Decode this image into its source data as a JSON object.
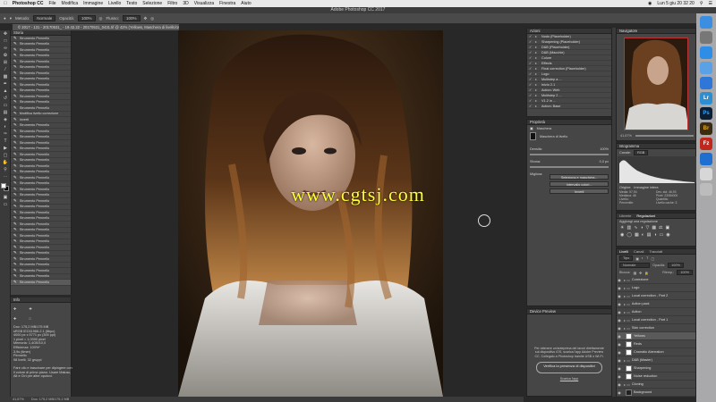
{
  "menubar": {
    "app_name": "Photoshop CC",
    "menus": [
      "File",
      "Modifica",
      "Immagine",
      "Livello",
      "Testo",
      "Selezione",
      "Filtro",
      "3D",
      "Visualizza",
      "Finestra",
      "Aiuto"
    ],
    "datetime": "Lun 5 giu  20 32 20"
  },
  "window_title": "Adobe Photoshop CC 2017",
  "options": {
    "metodo_label": "Metodo:",
    "metodo_value": "Normale",
    "opacita_label": "Opacità:",
    "opacita_value": "100%",
    "flusso_label": "Flusso:",
    "flusso_value": "100%"
  },
  "document_tab": "© 2017 - 131 - 20170531_ - 19.42.22 - 20170531_0431.tif @ 42% (Yellows, Maschera di livello/16) *",
  "history": {
    "title": "Storia",
    "items": [
      "Strumento Pennello",
      "Strumento Pennello",
      "Strumento Pennello",
      "Strumento Pennello",
      "Strumento Pennello",
      "Strumento Pennello",
      "Strumento Pennello",
      "Strumento Pennello",
      "Strumento Pennello",
      "Strumento Pennello",
      "Strumento Pennello",
      "Strumento Pennello",
      "Strumento Pennello",
      "Modifica livello correzione",
      "Inverti",
      "Strumento Pennello",
      "Strumento Pennello",
      "Strumento Pennello",
      "Strumento Pennello",
      "Strumento Pennello",
      "Strumento Pennello",
      "Strumento Pennello",
      "Strumento Pennello",
      "Strumento Pennello",
      "Strumento Pennello",
      "Strumento Pennello",
      "Strumento Pennello",
      "Strumento Pennello",
      "Strumento Pennello",
      "Strumento Pennello",
      "Strumento Pennello",
      "Strumento Pennello",
      "Strumento Pennello",
      "Strumento Pennello",
      "Strumento Pennello",
      "Strumento Pennello",
      "Strumento Pennello",
      "Strumento Pennello",
      "Strumento Pennello",
      "Strumento Pennello",
      "Strumento Pennello",
      "Strumento Pennello",
      "Strumento Pennello"
    ]
  },
  "info": {
    "title": "Info",
    "lines": [
      "Doc: 175,2 MB/175 MB",
      "sRGB IEC61966-2.1 (8bpc)",
      "4000 px x 5771 px (300 ppi)",
      "1 pixel = 1,0000 pixel",
      "Memoria: 1,4GB/10,0",
      "Efficienza: 100%*",
      "3,9s (timer)",
      "Pennello",
      "98 livelli, 32 gruppi",
      "",
      "Fare clic e trascinare per dipingere con",
      "il colore di primo piano. Usare Maiusc,",
      "Alt e Ctrl per altre opzioni."
    ]
  },
  "watermark": "www.cgtsj.com",
  "status": {
    "zoom": "41,67%",
    "doc": "Doc: 175,2 MB/175,2 MB"
  },
  "actions": {
    "title": "Azioni",
    "items": [
      "Nodo (Placeholder)",
      "Sharpening (Placeholder)",
      "D&B (Placeholder)",
      "D&B (Macchie)",
      "Colore",
      "Effects",
      "Final correction (Placeholder)",
      "Logo",
      "Multistep a ...",
      "Inizio 2.1",
      "Action: Web",
      "Multistep 2 ...",
      "V1.2 in ...",
      "Action: Base"
    ]
  },
  "properties": {
    "title": "Proprietà",
    "subtitle": "Maschera",
    "mask_label": "Maschera di livello",
    "density_label": "Densità:",
    "density_value": "100%",
    "feather_label": "Sfuma:",
    "feather_value": "0,0 px",
    "refine_label": "Migliora:",
    "btn_select_mask": "Seleziona e maschera...",
    "btn_color_range": "Intervallo colori...",
    "btn_invert": "Inverti"
  },
  "device_preview": {
    "title": "Device Preview",
    "text": "Per ottenere un'anteprima dei lavori direttamente sul dispositivo iOS, scarica l'app Adobe Preview CC. Collegalo a Photoshop tramite USB o Wi-Fi.",
    "button": "Verifica la presenza di dispositivi",
    "link": "Scarica l'app"
  },
  "navigator": {
    "title": "Navigatore",
    "zoom": "41,67%"
  },
  "histogram": {
    "title": "Istogramma",
    "channel_label": "Canale:",
    "channel_value": "RGB",
    "source_label": "Origine:",
    "source_value": "Immagine intera",
    "stats": [
      "Media: 57,94",
      "Dev. std: 46,93",
      "Mediana: 46",
      "Pixel: 23084000",
      "Livello:",
      "Quantità:",
      "Percentile:",
      "Livello cache: 3"
    ]
  },
  "libraries": {
    "tab_libraries": "Librerie",
    "tab_adjustments": "Regolazioni",
    "add_label": "Aggiungi una regolazione"
  },
  "layers": {
    "tab_layers": "Livelli",
    "tab_channels": "Canali",
    "tab_paths": "Tracciati",
    "kind_value": "Tipo",
    "blend_value": "Normale",
    "opacity_label": "Opacità:",
    "opacity_value": "100%",
    "fill_label": "Riemp.:",
    "fill_value": "100%",
    "lock_label": "Blocca:",
    "items": [
      {
        "name": "Correzione",
        "type": "group"
      },
      {
        "name": "Logo",
        "type": "group"
      },
      {
        "name": "Local correction - Part 2",
        "type": "group"
      },
      {
        "name": "Action pack",
        "type": "group"
      },
      {
        "name": "Action",
        "type": "group"
      },
      {
        "name": "Local correction - Part 1",
        "type": "group"
      },
      {
        "name": "Skin correction",
        "type": "group"
      },
      {
        "name": "Yellows",
        "type": "layer"
      },
      {
        "name": "Reds",
        "type": "layer"
      },
      {
        "name": "Cromatic Aberration",
        "type": "layer"
      },
      {
        "name": "D&B (Master)",
        "type": "group"
      },
      {
        "name": "Sharpening",
        "type": "layer"
      },
      {
        "name": "Noise reduction",
        "type": "layer"
      },
      {
        "name": "Cloning",
        "type": "group"
      },
      {
        "name": "Background",
        "type": "layer"
      }
    ]
  },
  "dock": {
    "icons": [
      "finder-icon",
      "launchpad-icon",
      "safari-icon",
      "mail-icon",
      "appstore-icon",
      "lightroom-icon",
      "photoshop-icon",
      "bridge-icon",
      "filezilla-icon",
      "teamviewer-icon",
      "preview-icon",
      "trash-icon"
    ],
    "labels": [
      "",
      "",
      "",
      "",
      "",
      "Lr",
      "Ps",
      "Br",
      "Fz",
      "",
      "",
      ""
    ]
  },
  "colors": {
    "panel_bg": "#464646",
    "canvas_bg": "#282828",
    "watermark": "#ffff33",
    "photoshop_blue": "#31a8ff",
    "lightroom_blue": "#2d8fd1"
  }
}
